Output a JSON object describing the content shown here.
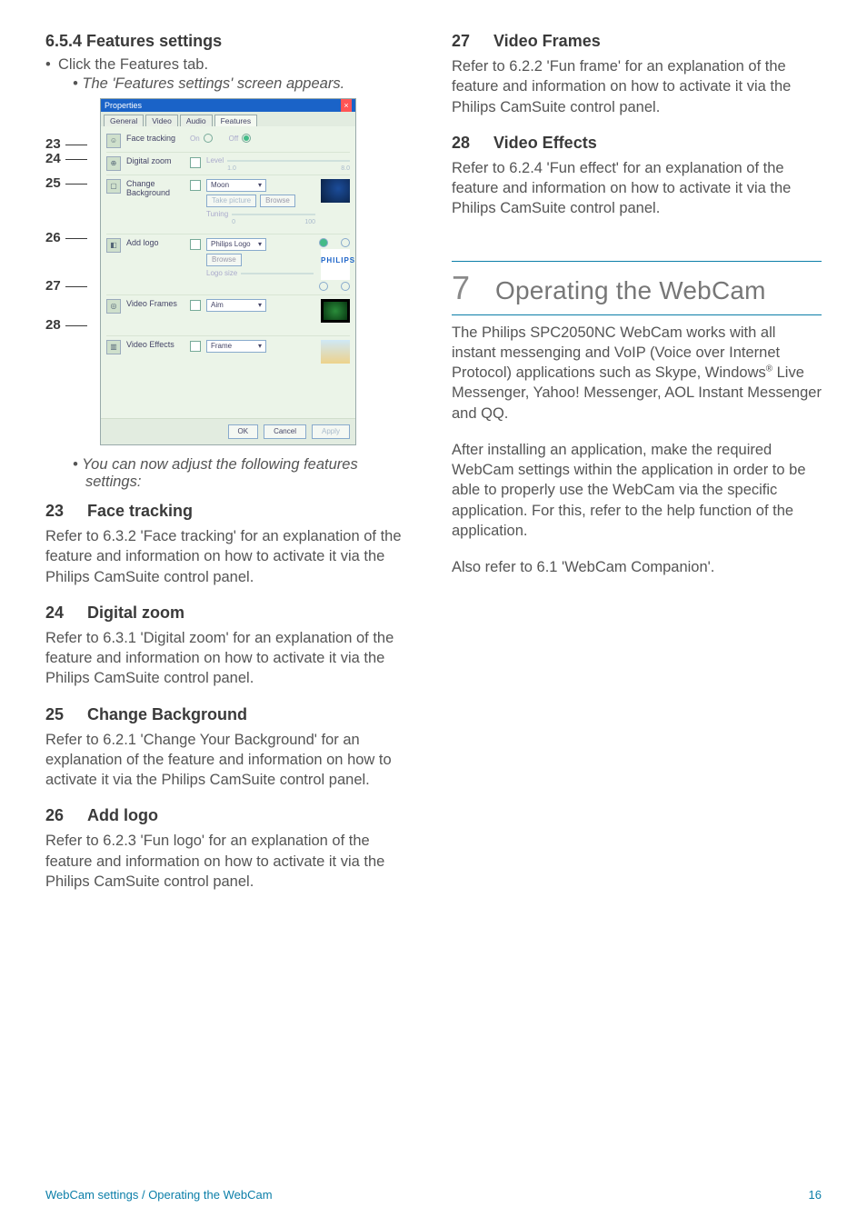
{
  "left": {
    "heading_654": "6.5.4   Features settings",
    "bullet1": "Click the Features tab.",
    "bullet1_sub": "The 'Features settings' screen appears.",
    "bullet2_line1": "You can now adjust the following features",
    "bullet2_line2": "settings:",
    "callouts": [
      "23",
      "24",
      "25",
      "26",
      "27",
      "28"
    ],
    "dialog": {
      "title": "Properties",
      "tabs": [
        "General",
        "Video",
        "Audio",
        "Features"
      ],
      "rows": {
        "face": {
          "label": "Face tracking",
          "on": "On",
          "off": "Off"
        },
        "zoom": {
          "label": "Digital zoom",
          "level": "Level",
          "min": "1.0",
          "max": "8.0"
        },
        "bg": {
          "label": "Change Background",
          "sel": "Moon",
          "take": "Take picture",
          "browse": "Browse",
          "tuning": "Tuning",
          "min": "0",
          "max": "100"
        },
        "logo": {
          "label": "Add logo",
          "sel": "Philips Logo",
          "browse": "Browse",
          "size": "Logo size",
          "brand": "PHILIPS"
        },
        "frames": {
          "label": "Video Frames",
          "sel": "Aim"
        },
        "effects": {
          "label": "Video Effects",
          "sel": "Frame"
        }
      },
      "buttons": {
        "ok": "OK",
        "cancel": "Cancel",
        "apply": "Apply"
      }
    },
    "s23_h": "Face tracking",
    "s23_n": "23",
    "s23_p": "Refer to 6.3.2 'Face tracking' for an explanation of the feature and information on how to activate it via the Philips CamSuite control panel.",
    "s24_h": "Digital zoom",
    "s24_n": "24",
    "s24_p": "Refer to 6.3.1 'Digital zoom' for an explanation of the feature and information on how to activate it via the Philips CamSuite control panel.",
    "s25_h": "Change Background",
    "s25_n": "25",
    "s25_p": "Refer to 6.2.1 'Change Your Background' for an explanation of the feature and information on how to activate it via the Philips CamSuite control panel.",
    "s26_h": "Add logo",
    "s26_n": "26",
    "s26_p": "Refer to 6.2.3 'Fun logo' for an explanation of the feature and information on how to activate it via the Philips CamSuite control panel."
  },
  "right": {
    "s27_h": "Video Frames",
    "s27_n": "27",
    "s27_p": "Refer to 6.2.2 'Fun frame' for an explanation of the feature and information on how to activate it via the Philips CamSuite control panel.",
    "s28_h": "Video Effects",
    "s28_n": "28",
    "s28_p": "Refer to 6.2.4 'Fun effect' for an explanation of the feature and information on how to activate it via the Philips CamSuite control panel.",
    "chapter_num": "7",
    "chapter_title": "Operating the WebCam",
    "para1_a": "The Philips SPC2050NC WebCam works with all instant messenging and VoIP (Voice over Internet Protocol) applications such as Skype, Windows",
    "para1_reg": "®",
    "para1_b": " Live Messenger, Yahoo! Messenger, AOL Instant Messenger and QQ.",
    "para2": "After installing an application, make the required WebCam settings within the application in order to be able to properly use the WebCam via the specific application. For this, refer to the help function of the application.",
    "para3": "Also refer to 6.1 'WebCam Companion'."
  },
  "footer": {
    "left": "WebCam settings / Operating the WebCam",
    "right": "16"
  }
}
